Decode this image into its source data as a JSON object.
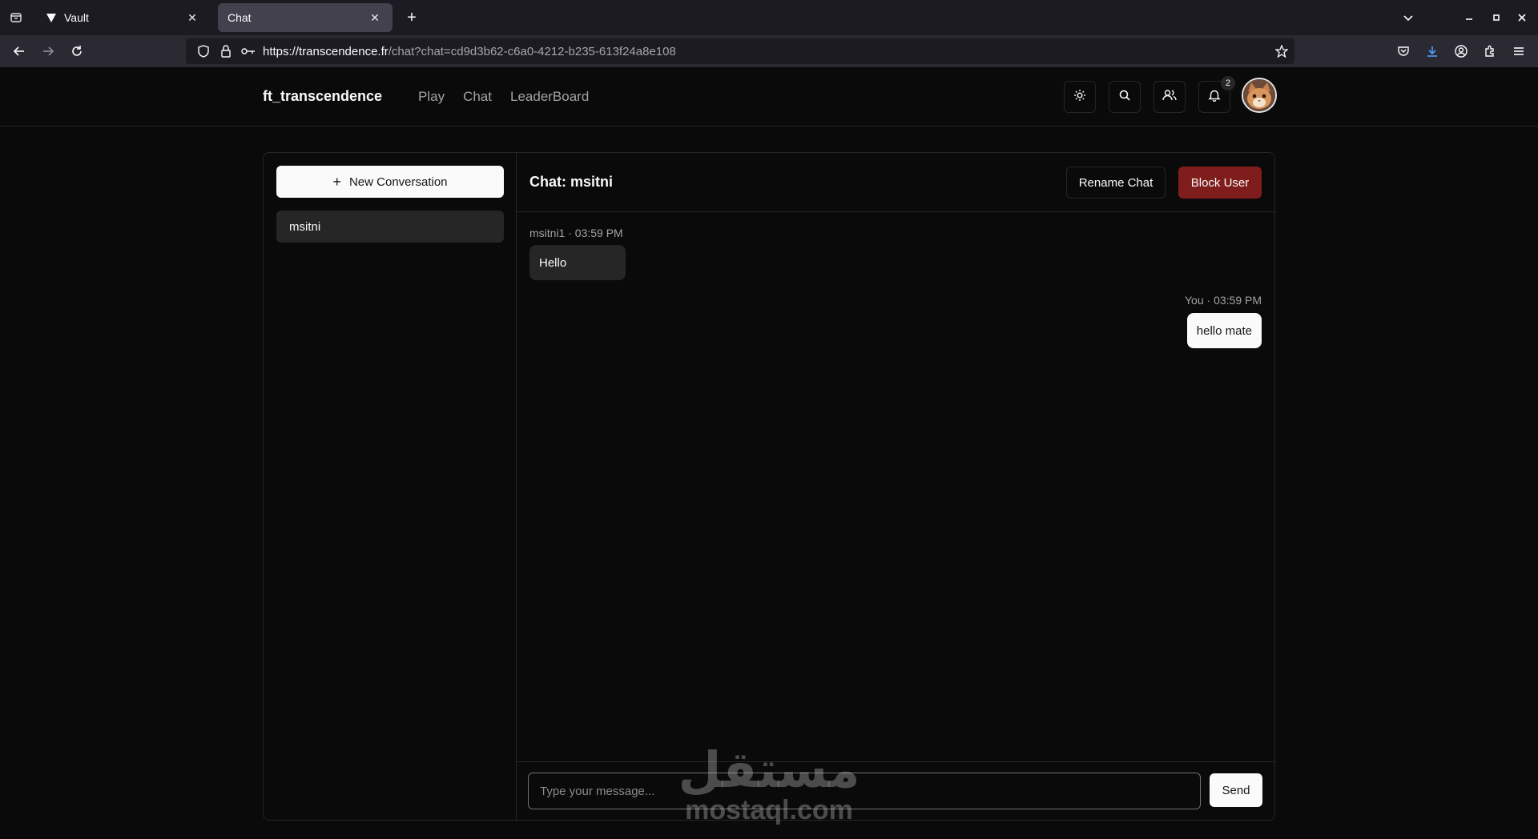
{
  "browser": {
    "tabs": [
      {
        "title": "Vault",
        "active": false
      },
      {
        "title": "Chat",
        "active": true
      }
    ],
    "url": {
      "host": "https://transcendence.fr",
      "path": "/chat?chat=cd9d3b62-c6a0-4212-b235-613f24a8e108"
    }
  },
  "header": {
    "brand": "ft_transcendence",
    "nav": [
      "Play",
      "Chat",
      "LeaderBoard"
    ],
    "notification_count": "2"
  },
  "sidebar": {
    "new_conversation_label": "New Conversation",
    "conversations": [
      {
        "name": "msitni",
        "selected": true
      }
    ]
  },
  "chat": {
    "title": "Chat: msitni",
    "rename_label": "Rename Chat",
    "block_label": "Block User",
    "messages": [
      {
        "meta": "msitni1 · 03:59 PM",
        "text": "Hello",
        "from": "them"
      },
      {
        "meta": "You · 03:59 PM",
        "text": "hello mate",
        "from": "me"
      }
    ],
    "input_placeholder": "Type your message...",
    "send_label": "Send"
  },
  "watermark": {
    "arabic": "مستقل",
    "latin": "mostaql.com"
  },
  "colors": {
    "background": "#0a0a0a",
    "border": "#262626",
    "danger": "#7f1d1d",
    "primary_button": "#fafafa"
  }
}
